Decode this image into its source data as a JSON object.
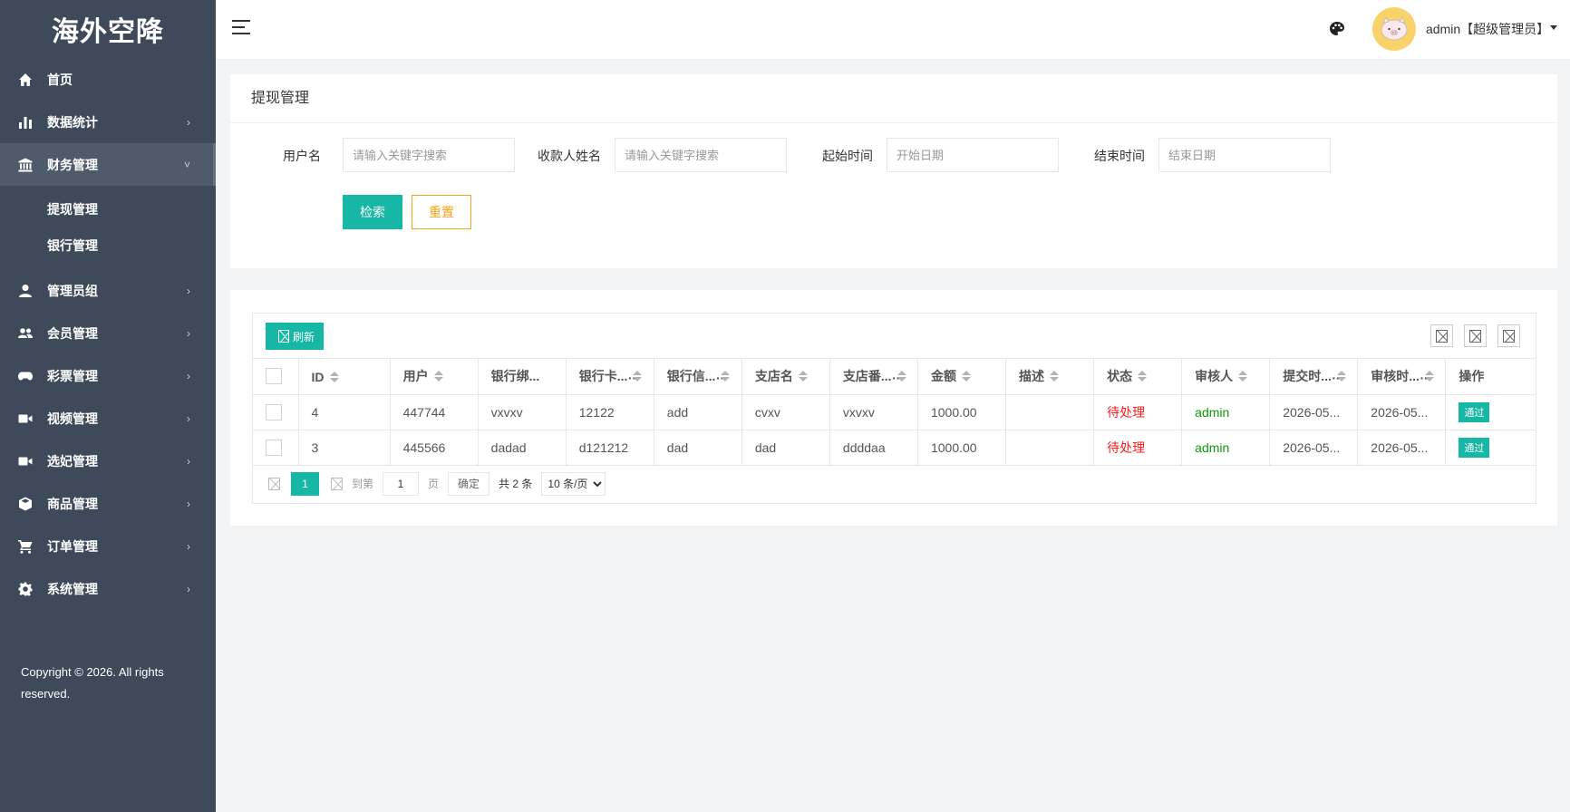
{
  "app": {
    "title": "海外空降"
  },
  "sidebar": {
    "items": [
      {
        "label": "首页",
        "icon": "home-icon"
      },
      {
        "label": "数据统计",
        "icon": "bar-chart-icon"
      },
      {
        "label": "财务管理",
        "icon": "bank-icon"
      },
      {
        "label": "管理员组",
        "icon": "person-icon"
      },
      {
        "label": "会员管理",
        "icon": "people-icon"
      },
      {
        "label": "彩票管理",
        "icon": "gamepad-icon"
      },
      {
        "label": "视频管理",
        "icon": "video-camera-icon"
      },
      {
        "label": "选妃管理",
        "icon": "video-camera-icon"
      },
      {
        "label": "商品管理",
        "icon": "box-icon"
      },
      {
        "label": "订单管理",
        "icon": "cart-icon"
      },
      {
        "label": "系统管理",
        "icon": "gear-icon"
      }
    ],
    "submenu": [
      "提现管理",
      "银行管理"
    ],
    "copyright": "Copyright © 2026. All rights reserved."
  },
  "header": {
    "user": "admin【超级管理员】",
    "palette_icon": "palette-icon",
    "avatar_icon": "pig-avatar-icon"
  },
  "search": {
    "title": "提现管理",
    "fields": [
      {
        "label": "用户名",
        "placeholder": "请输入关键字搜索"
      },
      {
        "label": "收款人姓名",
        "placeholder": "请输入关键字搜索"
      },
      {
        "label": "起始时间",
        "placeholder": "开始日期"
      },
      {
        "label": "结束时间",
        "placeholder": "结束日期"
      }
    ],
    "search_button": "检索",
    "reset_button": "重置"
  },
  "table": {
    "refresh_label": "刷新",
    "columns": [
      "ID",
      "用户",
      "银行绑...",
      "银行卡...",
      "银行信...",
      "支店名",
      "支店番...",
      "金额",
      "描述",
      "状态",
      "审核人",
      "提交时...",
      "审核时...",
      "操作"
    ],
    "rows": [
      {
        "id": "4",
        "user": "447744",
        "bank_bind": "vxvxv",
        "bank_card": "12122",
        "bank_info": "add",
        "branch": "cvxv",
        "branch_no": "vxvxv",
        "amount": "1000.00",
        "desc": "",
        "status": "待处理",
        "auditor": "admin",
        "submit_time": "2026-05...",
        "audit_time": "2026-05...",
        "action": "通过"
      },
      {
        "id": "3",
        "user": "445566",
        "bank_bind": "dadad",
        "bank_card": "d121212",
        "bank_info": "dad",
        "branch": "dad",
        "branch_no": "ddddaa",
        "amount": "1000.00",
        "desc": "",
        "status": "待处理",
        "auditor": "admin",
        "submit_time": "2026-05...",
        "audit_time": "2026-05...",
        "action": "通过"
      }
    ],
    "colors": {
      "accent": "#16b7a4",
      "pending": "#ff1c1c",
      "auditor": "#0a9b0a",
      "reset": "#f0a417"
    }
  },
  "pager": {
    "current": "1",
    "goto_label": "到第",
    "goto_value": "1",
    "page_label": "页",
    "confirm": "确定",
    "total": "共 2 条",
    "page_size": "10 条/页"
  }
}
